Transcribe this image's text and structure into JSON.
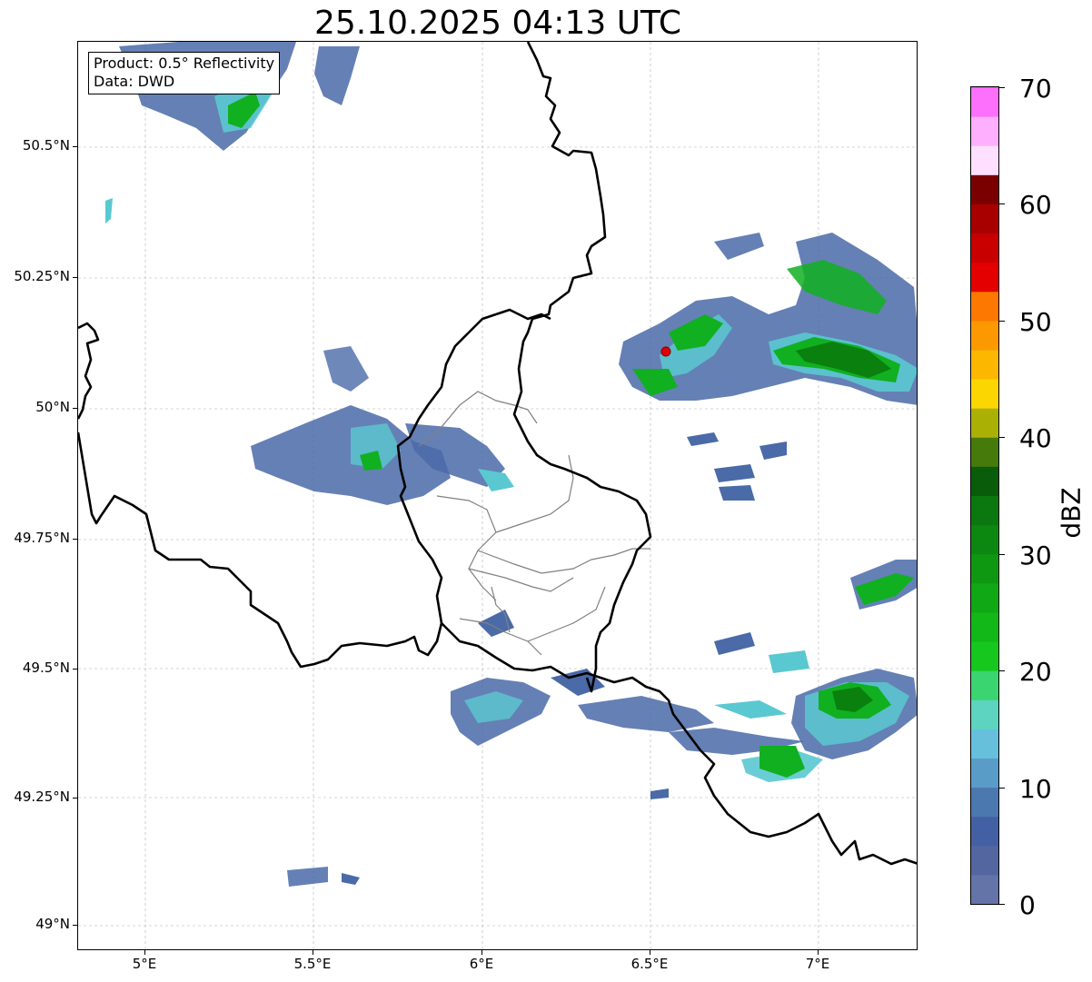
{
  "title": "25.10.2025 04:13 UTC",
  "info_box": {
    "product": "Product: 0.5° Reflectivity",
    "data": "Data: DWD"
  },
  "map": {
    "lon_range": [
      4.8,
      7.3
    ],
    "lat_range": [
      48.95,
      50.65
    ],
    "y_ticks": [
      "50.5°N",
      "50.25°N",
      "50°N",
      "49.75°N",
      "49.5°N",
      "49.25°N",
      "49°N"
    ],
    "y_tick_values": [
      50.5,
      50.25,
      50.0,
      49.75,
      49.5,
      49.25,
      49.0
    ],
    "x_ticks": [
      "5°E",
      "5.5°E",
      "6°E",
      "6.5°E",
      "7°E"
    ],
    "x_tick_values": [
      5.0,
      5.5,
      6.0,
      6.5,
      7.0
    ],
    "gridlines": true,
    "radar_site": {
      "lon": 6.55,
      "lat": 50.11,
      "color": "#e00000"
    },
    "border_color": "#000000",
    "admin_border_color": "#808080"
  },
  "colorbar": {
    "label": "dBZ",
    "tick_labels": [
      "0",
      "10",
      "20",
      "30",
      "40",
      "50",
      "60",
      "70"
    ],
    "range": [
      0,
      70
    ],
    "step": 2.5,
    "colors": [
      "#6474a8",
      "#5466a0",
      "#4460a4",
      "#4c78b0",
      "#5a9cc8",
      "#66c0dc",
      "#5cd4c0",
      "#3ad470",
      "#16c81e",
      "#12b818",
      "#10a814",
      "#0e9812",
      "#0c8810",
      "#0a780e",
      "#085c0a",
      "#467a0a",
      "#aab004",
      "#fcd600",
      "#fcb800",
      "#fc9800",
      "#fc7800",
      "#e40000",
      "#c80000",
      "#a80000",
      "#7a0000",
      "#fee0fe",
      "#feb0fe",
      "#fc70fc",
      "#e83ae8"
    ]
  },
  "legend_colors": {
    "low": "#4a6aa8",
    "mid": "#5ac8d0",
    "green": "#10b020",
    "dark_green": "#0a800e"
  }
}
